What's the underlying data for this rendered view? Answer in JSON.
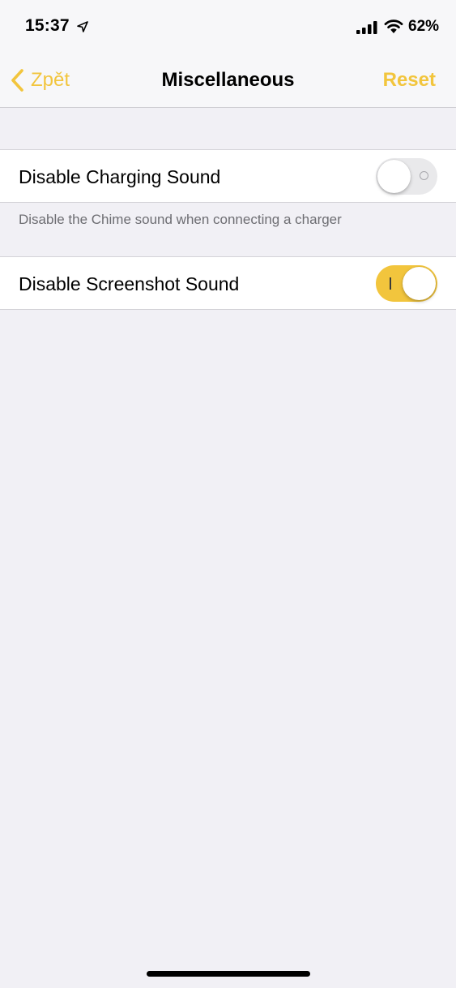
{
  "status_bar": {
    "time": "15:37",
    "battery": "62%",
    "icons": [
      "location-arrow-icon",
      "cellular-signal-icon",
      "wifi-icon"
    ]
  },
  "nav": {
    "back_label": "Zpět",
    "title": "Miscellaneous",
    "reset_label": "Reset"
  },
  "settings": {
    "charging": {
      "label": "Disable Charging Sound",
      "enabled": false,
      "footer": "Disable the Chime sound when connecting a charger"
    },
    "screenshot": {
      "label": "Disable Screenshot Sound",
      "enabled": true
    }
  },
  "colors": {
    "accent": "#f2c53d",
    "background": "#f1f0f5",
    "bar_background": "#f7f7f9"
  }
}
